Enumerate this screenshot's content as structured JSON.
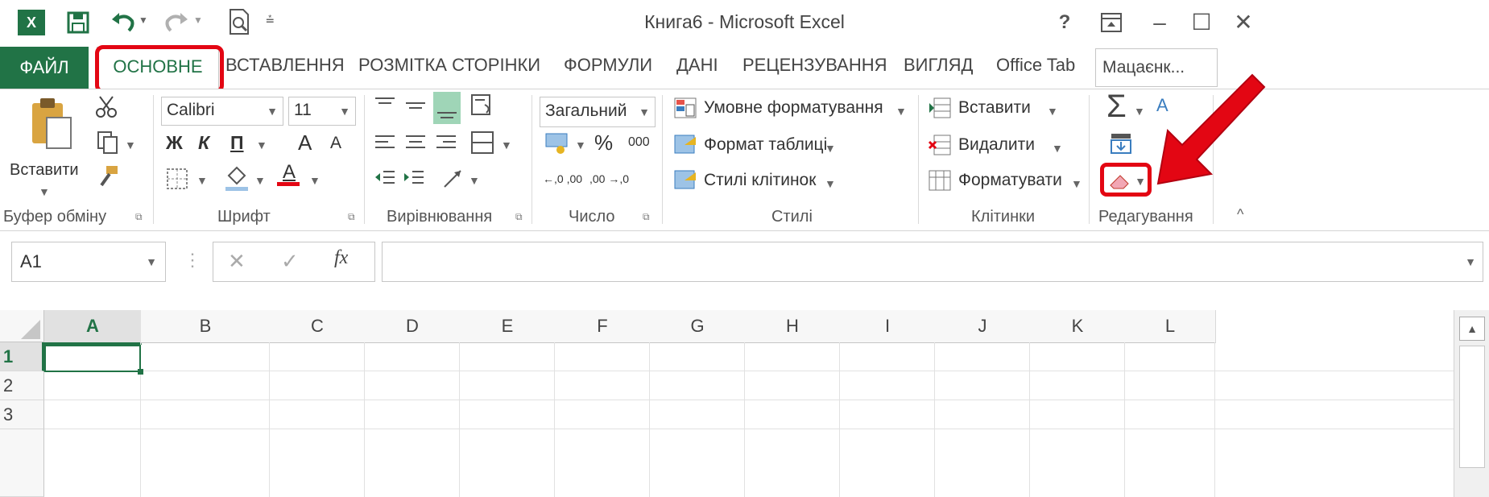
{
  "window": {
    "title": "Книга6 - Microsoft Excel",
    "help_label": "?",
    "minimize_label": "–",
    "restore_label": "☐",
    "close_label": "✕"
  },
  "tabs": {
    "file": "ФАЙЛ",
    "home": "ОСНОВНЕ",
    "insert": "ВСТАВЛЕННЯ",
    "page_layout": "РОЗМІТКА СТОРІНКИ",
    "formulas": "ФОРМУЛИ",
    "data": "ДАНІ",
    "review": "РЕЦЕНЗУВАННЯ",
    "view": "ВИГЛЯД",
    "office_tab": "Office Tab",
    "user": "Мацаєнк..."
  },
  "ribbon": {
    "clipboard": {
      "paste_label": "Вставити",
      "group_label": "Буфер обміну"
    },
    "font": {
      "font_name": "Calibri",
      "font_size": "11",
      "bold": "Ж",
      "italic": "К",
      "underline": "П",
      "grow": "A",
      "shrink": "A",
      "color_letter": "A",
      "group_label": "Шрифт"
    },
    "alignment": {
      "group_label": "Вирівнювання"
    },
    "number": {
      "format": "Загальний",
      "percent": "%",
      "thousands": "000",
      "inc_decimal": "←,0 ,00",
      "dec_decimal": ",00 →,0",
      "group_label": "Число"
    },
    "styles": {
      "conditional": "Умовне форматування",
      "table_format": "Формат таблиці",
      "cell_styles": "Стилі клітинок",
      "group_label": "Стилі"
    },
    "cells": {
      "insert": "Вставити",
      "delete": "Видалити",
      "format": "Форматувати",
      "group_label": "Клітинки"
    },
    "editing": {
      "group_label": "Редагування"
    }
  },
  "formula_bar": {
    "name_box": "A1",
    "fx": "fx",
    "formula": ""
  },
  "grid": {
    "columns": [
      "A",
      "B",
      "C",
      "D",
      "E",
      "F",
      "G",
      "H",
      "I",
      "J",
      "K",
      "L"
    ],
    "rows": [
      "1",
      "2",
      "3"
    ],
    "selected_cell": "A1"
  },
  "colors": {
    "accent": "#217346",
    "highlight": "#e30613"
  }
}
